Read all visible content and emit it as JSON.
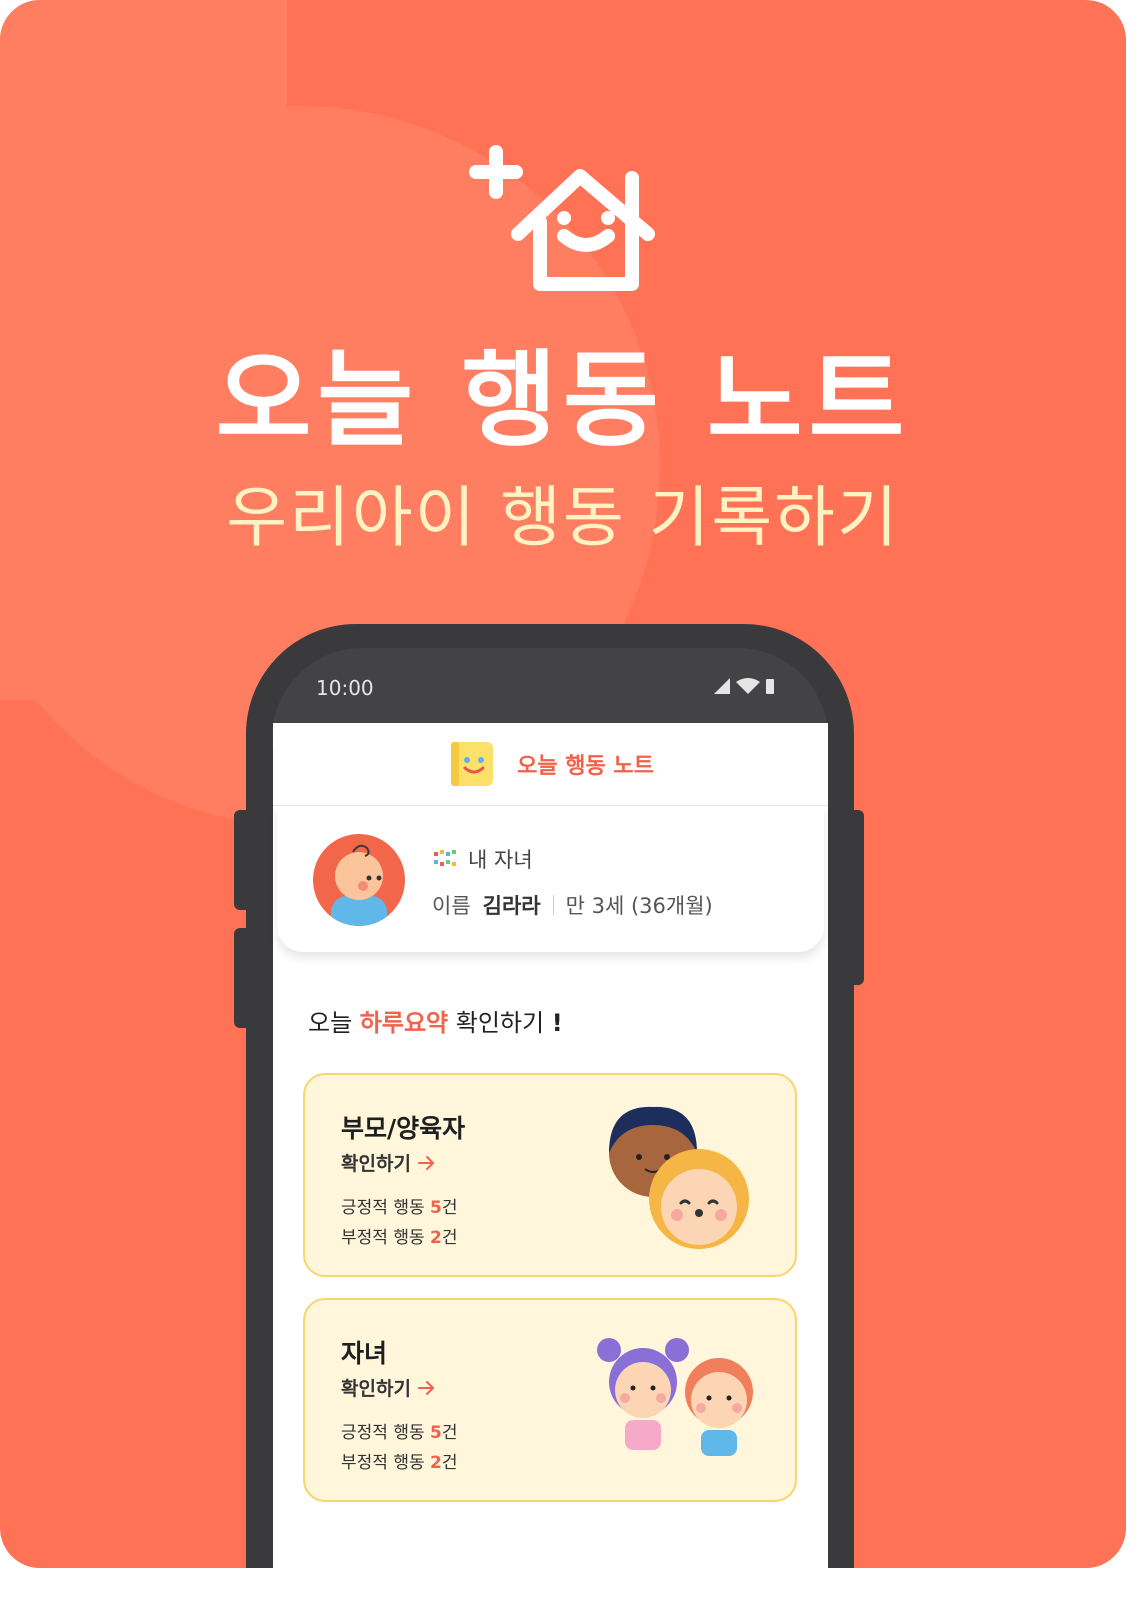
{
  "hero": {
    "title": "오늘 행동 노트",
    "subtitle": "우리아이 행동 기록하기"
  },
  "status_bar": {
    "time": "10:00"
  },
  "app": {
    "title": "오늘 행동 노트"
  },
  "profile": {
    "section_label": "내 자녀",
    "name_label": "이름",
    "name": "김라라",
    "age": "만 3세 (36개월)"
  },
  "summary": {
    "prefix": "오늘 ",
    "highlight": "하루요약",
    "suffix": " 확인하기",
    "exclaim": "!"
  },
  "cards": [
    {
      "title": "부모/양육자",
      "link": "확인하기",
      "positive_label": "긍정적 행동 ",
      "positive_count": "5",
      "negative_label": "부정적 행동 ",
      "negative_count": "2",
      "unit": "건"
    },
    {
      "title": "자녀",
      "link": "확인하기",
      "positive_label": "긍정적 행동 ",
      "positive_count": "5",
      "negative_label": "부정적 행동 ",
      "negative_count": "2",
      "unit": "건"
    }
  ],
  "colors": {
    "brand": "#FF7255",
    "accent": "#F2614A",
    "card_bg": "#FFF6DC",
    "card_border": "#F8D56B",
    "subtitle": "#FFF3C4"
  }
}
